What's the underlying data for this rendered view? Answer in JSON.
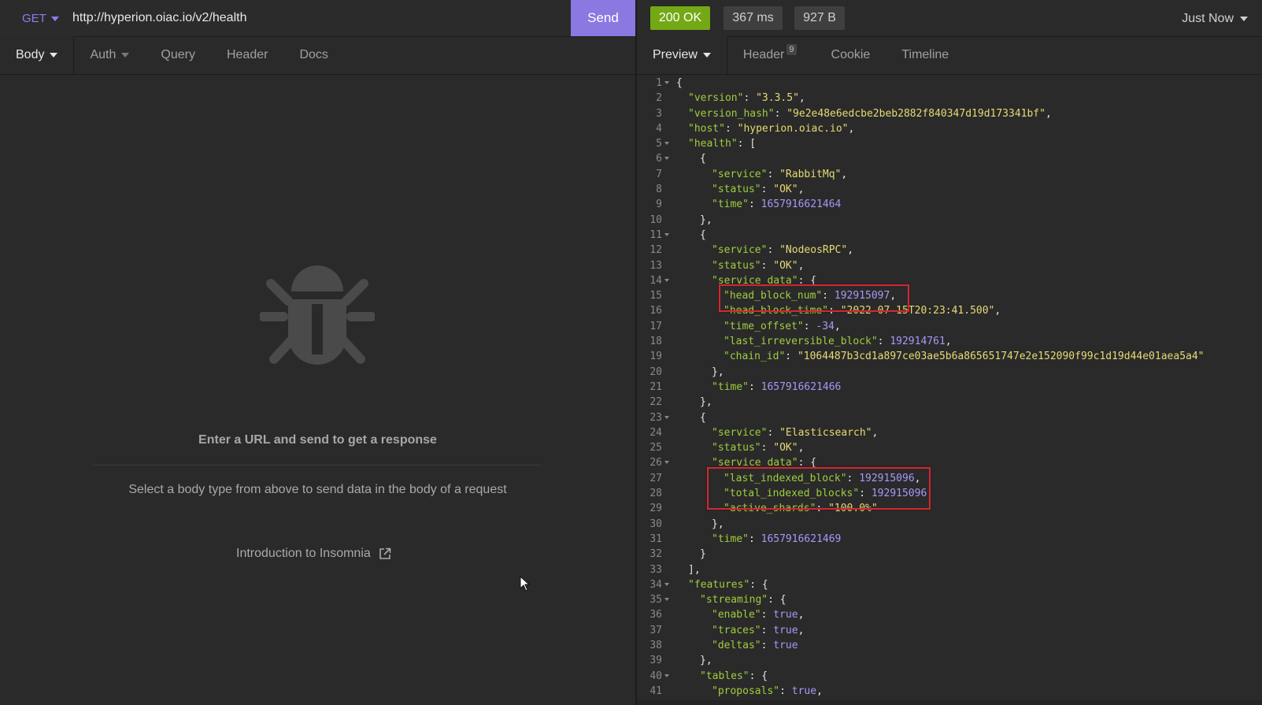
{
  "request": {
    "method": "GET",
    "url": "http://hyperion.oiac.io/v2/health",
    "send_label": "Send",
    "tabs": [
      "Body",
      "Auth",
      "Query",
      "Header",
      "Docs"
    ]
  },
  "empty_state": {
    "title": "Enter a URL and send to get a response",
    "subtitle": "Select a body type from above to send data in the body of a request",
    "link": "Introduction to Insomnia"
  },
  "response": {
    "status": "200 OK",
    "time": "367 ms",
    "size": "927 B",
    "history": "Just Now",
    "tabs": {
      "preview": "Preview",
      "header": "Header",
      "header_count": "9",
      "cookie": "Cookie",
      "timeline": "Timeline"
    },
    "lines": [
      {
        "n": "1",
        "fold": true,
        "indent": 0,
        "parts": [
          [
            "p",
            "{"
          ]
        ]
      },
      {
        "n": "2",
        "fold": false,
        "indent": 1,
        "parts": [
          [
            "k",
            "\"version\""
          ],
          [
            "p",
            ": "
          ],
          [
            "s",
            "\"3.3.5\""
          ],
          [
            "p",
            ","
          ]
        ]
      },
      {
        "n": "3",
        "fold": false,
        "indent": 1,
        "parts": [
          [
            "k",
            "\"version_hash\""
          ],
          [
            "p",
            ": "
          ],
          [
            "s",
            "\"9e2e48e6edcbe2beb2882f840347d19d173341bf\""
          ],
          [
            "p",
            ","
          ]
        ]
      },
      {
        "n": "4",
        "fold": false,
        "indent": 1,
        "parts": [
          [
            "k",
            "\"host\""
          ],
          [
            "p",
            ": "
          ],
          [
            "s",
            "\"hyperion.oiac.io\""
          ],
          [
            "p",
            ","
          ]
        ]
      },
      {
        "n": "5",
        "fold": true,
        "indent": 1,
        "parts": [
          [
            "k",
            "\"health\""
          ],
          [
            "p",
            ": ["
          ]
        ]
      },
      {
        "n": "6",
        "fold": true,
        "indent": 2,
        "parts": [
          [
            "p",
            "{"
          ]
        ]
      },
      {
        "n": "7",
        "fold": false,
        "indent": 3,
        "parts": [
          [
            "k",
            "\"service\""
          ],
          [
            "p",
            ": "
          ],
          [
            "s",
            "\"RabbitMq\""
          ],
          [
            "p",
            ","
          ]
        ]
      },
      {
        "n": "8",
        "fold": false,
        "indent": 3,
        "parts": [
          [
            "k",
            "\"status\""
          ],
          [
            "p",
            ": "
          ],
          [
            "s",
            "\"OK\""
          ],
          [
            "p",
            ","
          ]
        ]
      },
      {
        "n": "9",
        "fold": false,
        "indent": 3,
        "parts": [
          [
            "k",
            "\"time\""
          ],
          [
            "p",
            ": "
          ],
          [
            "n",
            "1657916621464"
          ]
        ]
      },
      {
        "n": "10",
        "fold": false,
        "indent": 2,
        "parts": [
          [
            "p",
            "},"
          ]
        ]
      },
      {
        "n": "11",
        "fold": true,
        "indent": 2,
        "parts": [
          [
            "p",
            "{"
          ]
        ]
      },
      {
        "n": "12",
        "fold": false,
        "indent": 3,
        "parts": [
          [
            "k",
            "\"service\""
          ],
          [
            "p",
            ": "
          ],
          [
            "s",
            "\"NodeosRPC\""
          ],
          [
            "p",
            ","
          ]
        ]
      },
      {
        "n": "13",
        "fold": false,
        "indent": 3,
        "parts": [
          [
            "k",
            "\"status\""
          ],
          [
            "p",
            ": "
          ],
          [
            "s",
            "\"OK\""
          ],
          [
            "p",
            ","
          ]
        ]
      },
      {
        "n": "14",
        "fold": true,
        "indent": 3,
        "parts": [
          [
            "k",
            "\"service_data\""
          ],
          [
            "p",
            ": {"
          ]
        ]
      },
      {
        "n": "15",
        "fold": false,
        "indent": 4,
        "parts": [
          [
            "k",
            "\"head_block_num\""
          ],
          [
            "p",
            ": "
          ],
          [
            "n",
            "192915097"
          ],
          [
            "p",
            ","
          ]
        ]
      },
      {
        "n": "16",
        "fold": false,
        "indent": 4,
        "parts": [
          [
            "k",
            "\"head_block_time\""
          ],
          [
            "p",
            ": "
          ],
          [
            "s",
            "\"2022-07-15T20:23:41.500\""
          ],
          [
            "p",
            ","
          ]
        ]
      },
      {
        "n": "17",
        "fold": false,
        "indent": 4,
        "parts": [
          [
            "k",
            "\"time_offset\""
          ],
          [
            "p",
            ": "
          ],
          [
            "n",
            "-34"
          ],
          [
            "p",
            ","
          ]
        ]
      },
      {
        "n": "18",
        "fold": false,
        "indent": 4,
        "parts": [
          [
            "k",
            "\"last_irreversible_block\""
          ],
          [
            "p",
            ": "
          ],
          [
            "n",
            "192914761"
          ],
          [
            "p",
            ","
          ]
        ]
      },
      {
        "n": "19",
        "fold": false,
        "indent": 4,
        "parts": [
          [
            "k",
            "\"chain_id\""
          ],
          [
            "p",
            ": "
          ],
          [
            "s",
            "\"1064487b3cd1a897ce03ae5b6a865651747e2e152090f99c1d19d44e01aea5a4\""
          ]
        ]
      },
      {
        "n": "20",
        "fold": false,
        "indent": 3,
        "parts": [
          [
            "p",
            "},"
          ]
        ]
      },
      {
        "n": "21",
        "fold": false,
        "indent": 3,
        "parts": [
          [
            "k",
            "\"time\""
          ],
          [
            "p",
            ": "
          ],
          [
            "n",
            "1657916621466"
          ]
        ]
      },
      {
        "n": "22",
        "fold": false,
        "indent": 2,
        "parts": [
          [
            "p",
            "},"
          ]
        ]
      },
      {
        "n": "23",
        "fold": true,
        "indent": 2,
        "parts": [
          [
            "p",
            "{"
          ]
        ]
      },
      {
        "n": "24",
        "fold": false,
        "indent": 3,
        "parts": [
          [
            "k",
            "\"service\""
          ],
          [
            "p",
            ": "
          ],
          [
            "s",
            "\"Elasticsearch\""
          ],
          [
            "p",
            ","
          ]
        ]
      },
      {
        "n": "25",
        "fold": false,
        "indent": 3,
        "parts": [
          [
            "k",
            "\"status\""
          ],
          [
            "p",
            ": "
          ],
          [
            "s",
            "\"OK\""
          ],
          [
            "p",
            ","
          ]
        ]
      },
      {
        "n": "26",
        "fold": true,
        "indent": 3,
        "parts": [
          [
            "k",
            "\"service_data\""
          ],
          [
            "p",
            ": {"
          ]
        ]
      },
      {
        "n": "27",
        "fold": false,
        "indent": 4,
        "parts": [
          [
            "k",
            "\"last_indexed_block\""
          ],
          [
            "p",
            ": "
          ],
          [
            "n",
            "192915096"
          ],
          [
            "p",
            ","
          ]
        ]
      },
      {
        "n": "28",
        "fold": false,
        "indent": 4,
        "parts": [
          [
            "k",
            "\"total_indexed_blocks\""
          ],
          [
            "p",
            ": "
          ],
          [
            "n",
            "192915096"
          ],
          [
            "p",
            ","
          ]
        ]
      },
      {
        "n": "29",
        "fold": false,
        "indent": 4,
        "parts": [
          [
            "k",
            "\"active_shards\""
          ],
          [
            "p",
            ": "
          ],
          [
            "s",
            "\"100.0%\""
          ]
        ]
      },
      {
        "n": "30",
        "fold": false,
        "indent": 3,
        "parts": [
          [
            "p",
            "},"
          ]
        ]
      },
      {
        "n": "31",
        "fold": false,
        "indent": 3,
        "parts": [
          [
            "k",
            "\"time\""
          ],
          [
            "p",
            ": "
          ],
          [
            "n",
            "1657916621469"
          ]
        ]
      },
      {
        "n": "32",
        "fold": false,
        "indent": 2,
        "parts": [
          [
            "p",
            "}"
          ]
        ]
      },
      {
        "n": "33",
        "fold": false,
        "indent": 1,
        "parts": [
          [
            "p",
            "],"
          ]
        ]
      },
      {
        "n": "34",
        "fold": true,
        "indent": 1,
        "parts": [
          [
            "k",
            "\"features\""
          ],
          [
            "p",
            ": {"
          ]
        ]
      },
      {
        "n": "35",
        "fold": true,
        "indent": 2,
        "parts": [
          [
            "k",
            "\"streaming\""
          ],
          [
            "p",
            ": {"
          ]
        ]
      },
      {
        "n": "36",
        "fold": false,
        "indent": 3,
        "parts": [
          [
            "k",
            "\"enable\""
          ],
          [
            "p",
            ": "
          ],
          [
            "n",
            "true"
          ],
          [
            "p",
            ","
          ]
        ]
      },
      {
        "n": "37",
        "fold": false,
        "indent": 3,
        "parts": [
          [
            "k",
            "\"traces\""
          ],
          [
            "p",
            ": "
          ],
          [
            "n",
            "true"
          ],
          [
            "p",
            ","
          ]
        ]
      },
      {
        "n": "38",
        "fold": false,
        "indent": 3,
        "parts": [
          [
            "k",
            "\"deltas\""
          ],
          [
            "p",
            ": "
          ],
          [
            "n",
            "true"
          ]
        ]
      },
      {
        "n": "39",
        "fold": false,
        "indent": 2,
        "parts": [
          [
            "p",
            "},"
          ]
        ]
      },
      {
        "n": "40",
        "fold": true,
        "indent": 2,
        "parts": [
          [
            "k",
            "\"tables\""
          ],
          [
            "p",
            ": {"
          ]
        ]
      },
      {
        "n": "41",
        "fold": false,
        "indent": 3,
        "parts": [
          [
            "k",
            "\"proposals\""
          ],
          [
            "p",
            ": "
          ],
          [
            "n",
            "true"
          ],
          [
            "p",
            ","
          ]
        ]
      }
    ]
  },
  "colors": {
    "accent": "#8b78e0",
    "status_ok": "#74a814",
    "json_key": "#9fce3e",
    "json_string": "#e6db74",
    "json_number": "#a898f8",
    "highlight_box": "#d6262e"
  },
  "icons": {
    "method_dropdown": "chevron-down-icon",
    "empty_state": "bug-icon",
    "external_link": "external-link-icon",
    "mouse_pointer": "cursor-icon"
  }
}
